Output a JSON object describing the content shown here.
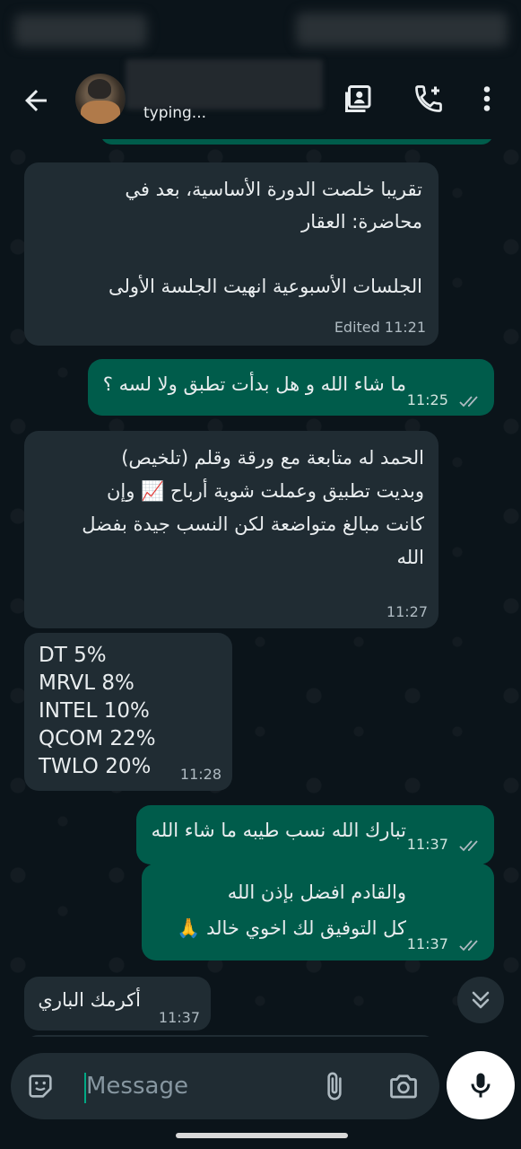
{
  "header": {
    "status_text": "typing..."
  },
  "messages": [
    {
      "direction": "in",
      "lines": [
        "تقريبا خلصت الدورة الأساسية، بعد في",
        "محاضرة: العقار",
        "",
        "الجلسات الأسبوعية انهيت الجلسة الأولى"
      ],
      "edited_label": "Edited",
      "time": "11:21"
    },
    {
      "direction": "out",
      "lines": [
        "ما شاء الله و هل بدأت تطبق ولا لسه ؟"
      ],
      "time": "11:25",
      "status": "read"
    },
    {
      "direction": "in",
      "lines": [
        "الحمد له متابعة مع ورقة وقلم (تلخيص)",
        "وبديت تطبيق وعملت شوية أرباح 📈 وإن",
        "كانت مبالغ متواضعة لكن النسب جيدة بفضل",
        "الله"
      ],
      "time": "11:27"
    },
    {
      "direction": "in",
      "lines": [
        "DT 5%",
        "MRVL 8%",
        "INTEL 10%",
        "QCOM 22%",
        "TWLO 20%"
      ],
      "time": "11:28"
    },
    {
      "direction": "out",
      "lines": [
        "تبارك الله نسب طيبه ما شاء الله"
      ],
      "time": "11:37",
      "status": "read"
    },
    {
      "direction": "out",
      "lines": [
        "والقادم افضل بإذن الله",
        "كل التوفيق لك اخوي خالد 🙏"
      ],
      "time": "11:37",
      "status": "read"
    },
    {
      "direction": "in",
      "lines": [
        "أكرمك الباري"
      ],
      "time": "11:37"
    }
  ],
  "composer": {
    "placeholder": "Message"
  },
  "colors": {
    "background": "#0b141a",
    "incoming_bubble": "#202c33",
    "outgoing_bubble": "#005c4b",
    "read_ticks": "#aebac1"
  },
  "icons": [
    "back-arrow-icon",
    "contact-card-icon",
    "add-call-icon",
    "more-vert-icon",
    "emoji-icon",
    "attach-icon",
    "camera-icon",
    "mic-icon",
    "double-chevron-down-icon",
    "double-check-icon"
  ]
}
